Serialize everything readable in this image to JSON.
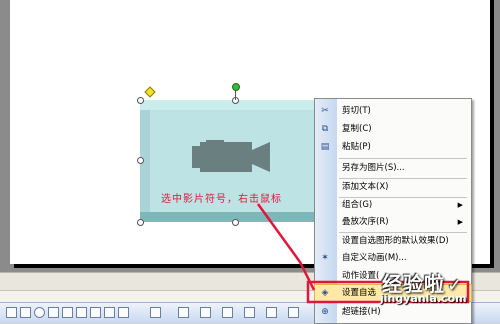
{
  "annotation": "选中影片符号，右击鼠标",
  "context_menu": {
    "items": [
      {
        "label": "剪切(T)",
        "icon": "scissors-icon",
        "glyph": "✂"
      },
      {
        "label": "复制(C)",
        "icon": "copy-icon",
        "glyph": "⧉"
      },
      {
        "label": "粘贴(P)",
        "icon": "paste-icon",
        "glyph": "▤"
      },
      {
        "label": "另存为图片(S)...",
        "icon": "",
        "glyph": ""
      },
      {
        "label": "添加文本(X)",
        "icon": "",
        "glyph": ""
      },
      {
        "label": "组合(G)",
        "icon": "",
        "glyph": "",
        "submenu": true
      },
      {
        "label": "叠放次序(R)",
        "icon": "",
        "glyph": "",
        "submenu": true
      },
      {
        "label": "设置自选图形的默认效果(D)",
        "icon": "",
        "glyph": ""
      },
      {
        "label": "自定义动画(M)...",
        "icon": "custom-animation-icon",
        "glyph": "✶"
      },
      {
        "label": "动作设置(",
        "icon": "",
        "glyph": ""
      },
      {
        "label": "设置自选",
        "icon": "format-shape-icon",
        "glyph": "◈"
      },
      {
        "label": "超链接(H)",
        "icon": "hyperlink-icon",
        "glyph": "⊕"
      }
    ]
  },
  "watermark": {
    "main": "经验啦",
    "check": "✓",
    "url": "jingyanla.com"
  },
  "colors": {
    "annotation_red": "#e0163a",
    "shape_fill": "#bde3e4",
    "menu_highlight": "#ffe9a8"
  }
}
